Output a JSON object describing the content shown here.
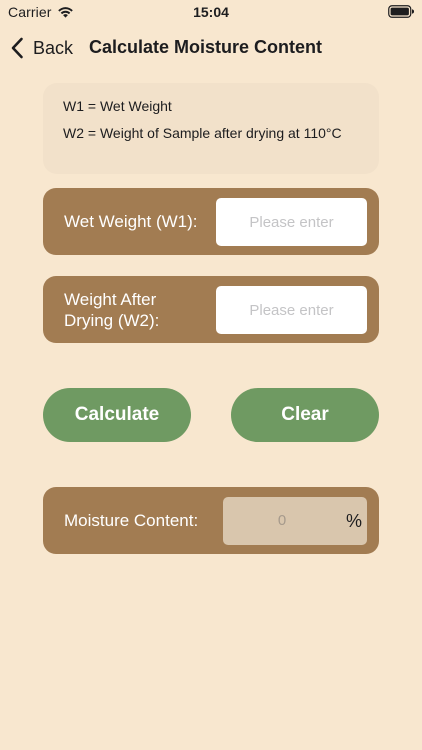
{
  "status_bar": {
    "carrier": "Carrier",
    "time": "15:04",
    "wifi_icon": "wifi-icon",
    "battery_icon": "battery-full-icon"
  },
  "nav": {
    "back_label": "Back",
    "back_icon": "chevron-left-icon",
    "title": "Calculate Moisture Content"
  },
  "info": {
    "w1_definition": "W1 = Wet Weight",
    "w2_definition": "W2 = Weight of Sample after drying at 110°C"
  },
  "form": {
    "wet_weight": {
      "label": "Wet Weight (W1):",
      "placeholder": "Please enter",
      "value": ""
    },
    "dry_weight": {
      "label": "Weight After Drying (W2):",
      "placeholder": "Please enter",
      "value": ""
    }
  },
  "actions": {
    "calculate_label": "Calculate",
    "clear_label": "Clear"
  },
  "result": {
    "label": "Moisture Content:",
    "value": "0",
    "unit": "%"
  },
  "colors": {
    "background": "#f8e7cf",
    "card": "#a27c52",
    "info_card": "#f2e1ca",
    "button": "#6f9a62",
    "result_box": "#d9c6ad"
  }
}
